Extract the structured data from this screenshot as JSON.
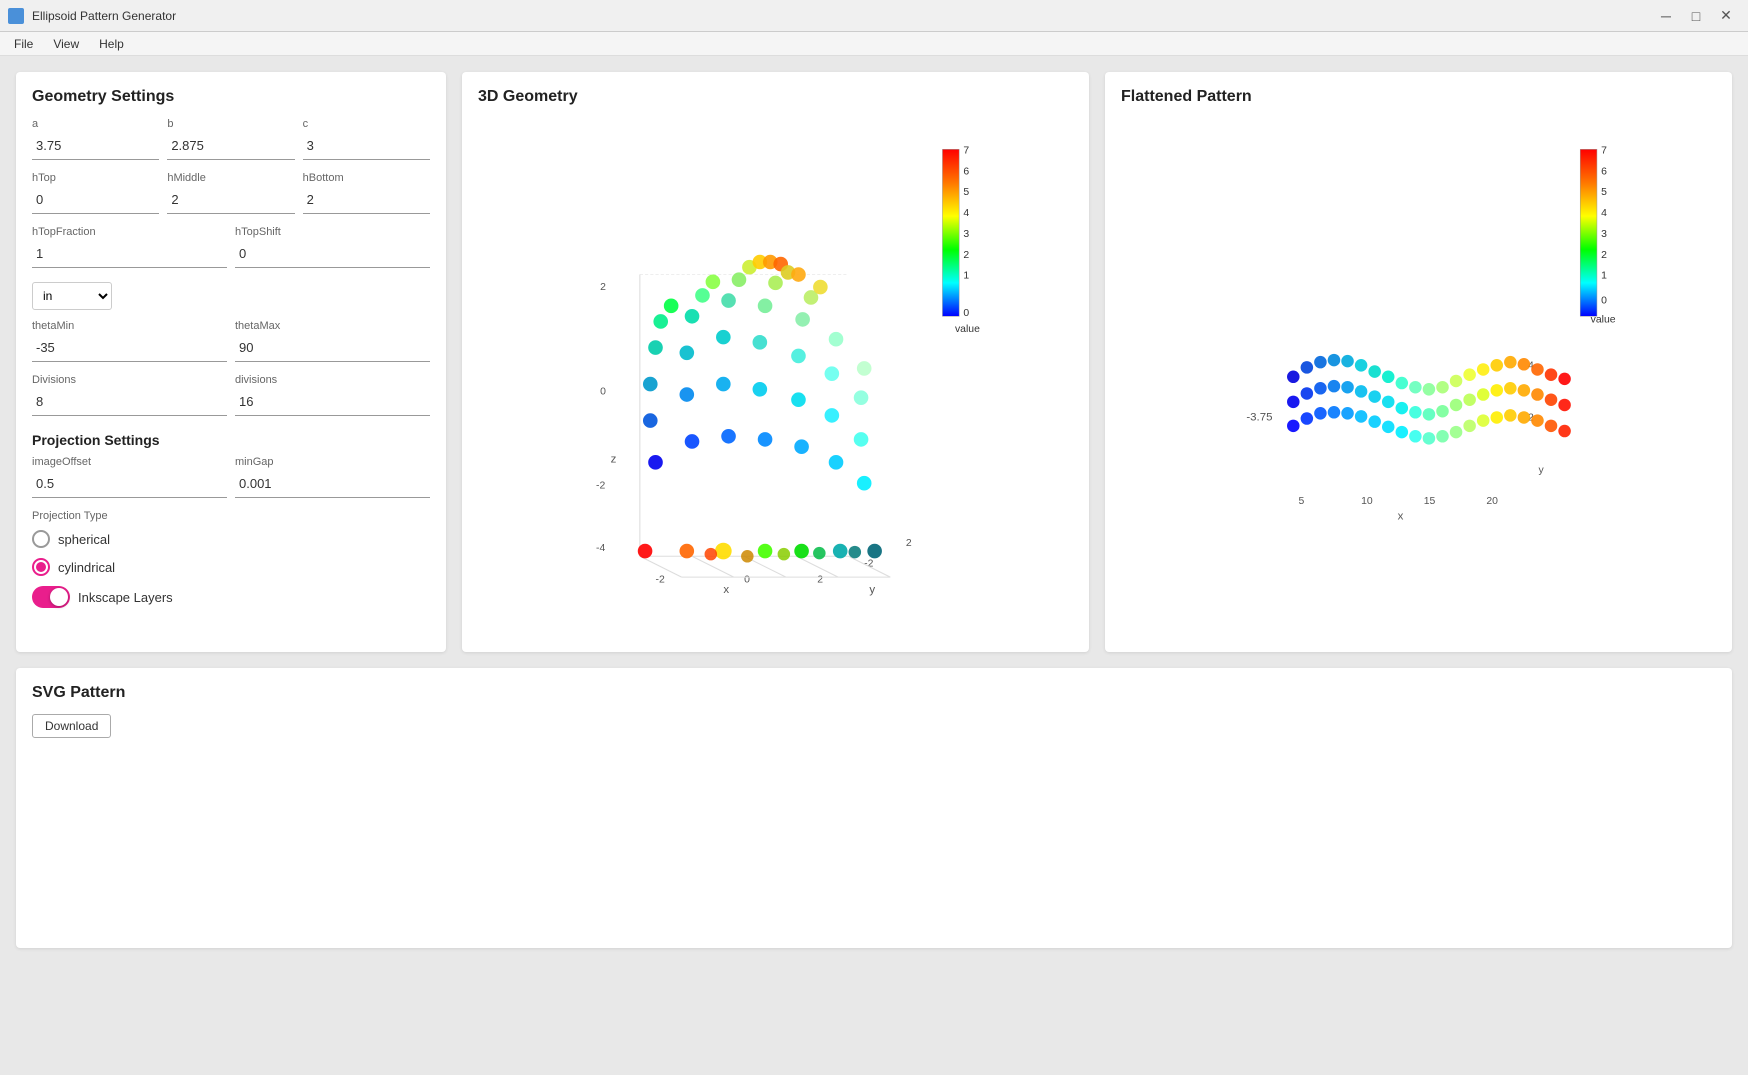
{
  "app": {
    "title": "Ellipsoid Pattern Generator",
    "icon": "ellipsoid-icon"
  },
  "titlebar": {
    "minimize_label": "─",
    "maximize_label": "□",
    "close_label": "✕"
  },
  "menu": {
    "items": [
      "File",
      "View",
      "Help"
    ]
  },
  "geometry_settings": {
    "title": "Geometry Settings",
    "fields": {
      "a_label": "a",
      "a_value": "3.75",
      "b_label": "b",
      "b_value": "2.875",
      "c_label": "c",
      "c_value": "3",
      "hTop_label": "hTop",
      "hTop_value": "0",
      "hMiddle_label": "hMiddle",
      "hMiddle_value": "2",
      "hBottom_label": "hBottom",
      "hBottom_value": "2",
      "hTopFraction_label": "hTopFraction",
      "hTopFraction_value": "1",
      "hTopShift_label": "hTopShift",
      "hTopShift_value": "0",
      "unit_value": "in",
      "thetaMin_label": "thetaMin",
      "thetaMin_value": "-35",
      "thetaMax_label": "thetaMax",
      "thetaMax_value": "90",
      "divisions_label": "Divisions",
      "divisions_value": "8",
      "divisions2_label": "divisions",
      "divisions2_value": "16"
    }
  },
  "projection_settings": {
    "title": "Projection Settings",
    "imageOffset_label": "imageOffset",
    "imageOffset_value": "0.5",
    "minGap_label": "minGap",
    "minGap_value": "0.001",
    "projection_type_label": "Projection Type",
    "radio_spherical": "spherical",
    "radio_cylindrical": "cylindrical",
    "toggle_label": "Inkscape Layers"
  },
  "geometry_chart": {
    "title": "3D Geometry",
    "colorbar_values": [
      "7",
      "6",
      "5",
      "4",
      "3",
      "2",
      "1",
      "0"
    ],
    "colorbar_label": "value",
    "axis_labels": {
      "x": "x",
      "y": "y",
      "z": "z"
    }
  },
  "flattened_chart": {
    "title": "Flattened Pattern",
    "colorbar_values": [
      "7",
      "6",
      "5",
      "4",
      "3",
      "2",
      "1",
      "0"
    ],
    "colorbar_label": "value",
    "axis_x_label": "x",
    "axis_y_label": "y",
    "x_tick_0": "-3.75",
    "x_ticks": [
      "5",
      "10",
      "15",
      "20"
    ],
    "y_ticks": [
      "4",
      "2",
      "y"
    ]
  },
  "svg_pattern": {
    "title": "SVG Pattern",
    "download_label": "Download"
  }
}
